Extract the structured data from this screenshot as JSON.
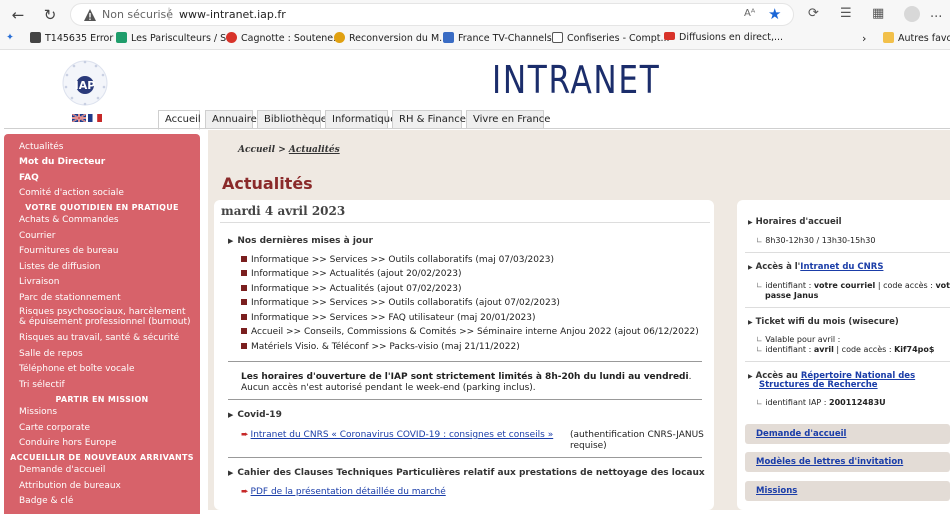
{
  "browser": {
    "security_label": "Non sécurisé",
    "separator": "|",
    "url": "www-intranet.iap.fr",
    "reader_label": "Aᴬ",
    "more_label": "..."
  },
  "favorites": [
    {
      "label": "T145635 Error i...",
      "color": "#444444"
    },
    {
      "label": "Les Parisculteurs / S...",
      "color": "#1f9d6b"
    },
    {
      "label": "Cagnotte : Soutene...",
      "color": "#d8332a"
    },
    {
      "label": "Reconversion du M...",
      "color": "#e0a010"
    },
    {
      "label": "France TV-Channels...",
      "color": "#3a6cc4"
    },
    {
      "label": "Confiseries - Compt...",
      "color": "#555555"
    },
    {
      "label": "Diffusions en direct,...",
      "color": "#d8332a"
    }
  ],
  "favorites_more": "Autres favoris",
  "header": {
    "logo_text": "IAP",
    "title": "INTRANET"
  },
  "tabs": [
    {
      "label": "Accueil",
      "active": true
    },
    {
      "label": "Annuaire",
      "active": false
    },
    {
      "label": "Bibliothèque",
      "active": false
    },
    {
      "label": "Informatique",
      "active": false
    },
    {
      "label": "RH & Finance",
      "active": false
    },
    {
      "label": "Vivre en France",
      "active": false
    }
  ],
  "sidebar": {
    "items_top": [
      {
        "label": "Actualités",
        "bold": false
      },
      {
        "label": "Mot du Directeur",
        "bold": true
      },
      {
        "label": "FAQ",
        "bold": true
      },
      {
        "label": "Comité d'action sociale",
        "bold": false
      }
    ],
    "section1": "VOTRE QUOTIDIEN EN PRATIQUE",
    "items_section1": [
      "Achats & Commandes",
      "Courrier",
      "Fournitures de bureau",
      "Listes de diffusion",
      "Livraison",
      "Parc de stationnement",
      "Risques psychosociaux, harcèlement & épuisement professionnel (burnout)",
      "Risques au travail, santé & sécurité",
      "Salle de repos",
      "Téléphone et boîte vocale",
      "Tri sélectif"
    ],
    "section2": "PARTIR EN MISSION",
    "items_section2": [
      "Missions",
      "Carte corporate",
      "Conduire hors Europe"
    ],
    "section3": "ACCUEILLIR DE NOUVEAUX ARRIVANTS",
    "items_section3": [
      "Demande d'accueil",
      "Attribution de bureaux",
      "Badge & clé"
    ]
  },
  "main": {
    "breadcrumb_home": "Accueil",
    "breadcrumb_sep": ">",
    "breadcrumb_current": "Actualités",
    "page_title": "Actualités",
    "date": "mardi 4 avril 2023",
    "updates_title": "Nos dernières mises à jour",
    "updates": [
      "Informatique >> Services >> Outils collaboratifs (maj 07/03/2023)",
      "Informatique >> Actualités (ajout 20/02/2023)",
      "Informatique >> Actualités (ajout 07/02/2023)",
      "Informatique >> Services >> Outils collaboratifs (ajout 07/02/2023)",
      "Informatique >> Services >> FAQ utilisateur (maj 20/01/2023)",
      "Accueil >> Conseils, Commissions & Comités >> Séminaire interne Anjou 2022 (ajout 06/12/2022)",
      "Matériels Visio. & Téléconf >> Packs-visio (maj 21/11/2022)"
    ],
    "horaires_bold": "Les horaires d'ouverture de l'IAP sont strictement limités à 8h-20h du lundi au vendredi",
    "horaires_text": ". Aucun accès n'est autorisé pendant le week-end (parking inclus).",
    "covid_title": "Covid-19",
    "covid_link": "Intranet du CNRS « Coronavirus COVID-19 : consignes et conseils »",
    "covid_note": "(authentification CNRS-JANUS requise)",
    "cctp_title": "Cahier des Clauses Techniques Particulières relatif aux prestations de nettoyage des locaux",
    "cctp_link": "PDF de la présentation détaillée du marché"
  },
  "right": {
    "horaires_title": "Horaires d'accueil",
    "horaires_value": "8h30-12h30 / 13h30-15h30",
    "acces_prefix": "Accès à l'",
    "acces_link": "Intranet du CNRS",
    "acces_line1_a": "identifiant : ",
    "acces_line1_b": "votre courriel",
    "acces_line1_c": " | code accès : ",
    "acces_line1_d": "votre m",
    "acces_line2": "passe Janus",
    "wifi_title": "Ticket wifi du mois (wisecure)",
    "wifi_line1": "Valable pour avril :",
    "wifi_line2_a": "identifiant : ",
    "wifi_line2_b": "avril",
    "wifi_line2_c": " | code accès : ",
    "wifi_line2_d": "Kif74po$",
    "rnsr_prefix": "Accès au ",
    "rnsr_link1": "Répertoire National des",
    "rnsr_link2": "Structures de Recherche",
    "rnsr_line_a": "identifiant IAP : ",
    "rnsr_line_b": "200112483U",
    "buttons": [
      "Demande d'accueil",
      "Modèles de lettres d'invitation",
      "Missions"
    ]
  }
}
